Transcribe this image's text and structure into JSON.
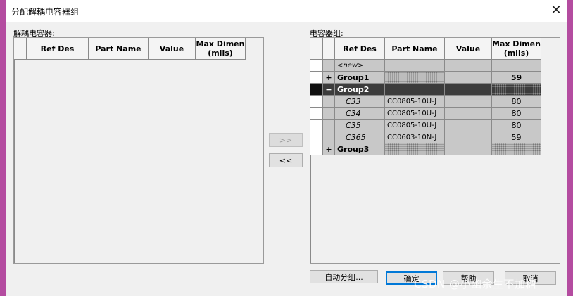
{
  "window": {
    "title": "分配解耦电容器组",
    "close_glyph": "✕"
  },
  "left_panel": {
    "label": "解耦电容器:",
    "columns": [
      "Ref Des",
      "Part Name",
      "Value",
      "Max Dimen\n(mils)"
    ]
  },
  "right_panel": {
    "label": "电容器组:",
    "columns": [
      "Ref Des",
      "Part Name",
      "Value",
      "Max Dimen\n(mils)"
    ],
    "rows": [
      {
        "expander": "",
        "ref": "<new>",
        "part": "",
        "value": "",
        "max": ""
      },
      {
        "expander": "+",
        "ref": "Group1",
        "part": "",
        "value": "",
        "max": "59"
      },
      {
        "expander": "−",
        "ref": "Group2",
        "part": "",
        "value": "",
        "max": ""
      },
      {
        "expander": "",
        "ref": "C33",
        "part": "CC0805-10U-J",
        "value": "",
        "max": "80"
      },
      {
        "expander": "",
        "ref": "C34",
        "part": "CC0805-10U-J",
        "value": "",
        "max": "80"
      },
      {
        "expander": "",
        "ref": "C35",
        "part": "CC0805-10U-J",
        "value": "",
        "max": "80"
      },
      {
        "expander": "",
        "ref": "C365",
        "part": "CC0603-10N-J",
        "value": "",
        "max": "59"
      },
      {
        "expander": "+",
        "ref": "Group3",
        "part": "",
        "value": "",
        "max": ""
      }
    ]
  },
  "transfer": {
    "move_right": ">>",
    "move_left": "<<"
  },
  "buttons": {
    "auto_group": "自动分组...",
    "ok": "确定",
    "help": "帮助",
    "cancel": "取消"
  },
  "watermark": "CSDN @小幽余生不加糖"
}
